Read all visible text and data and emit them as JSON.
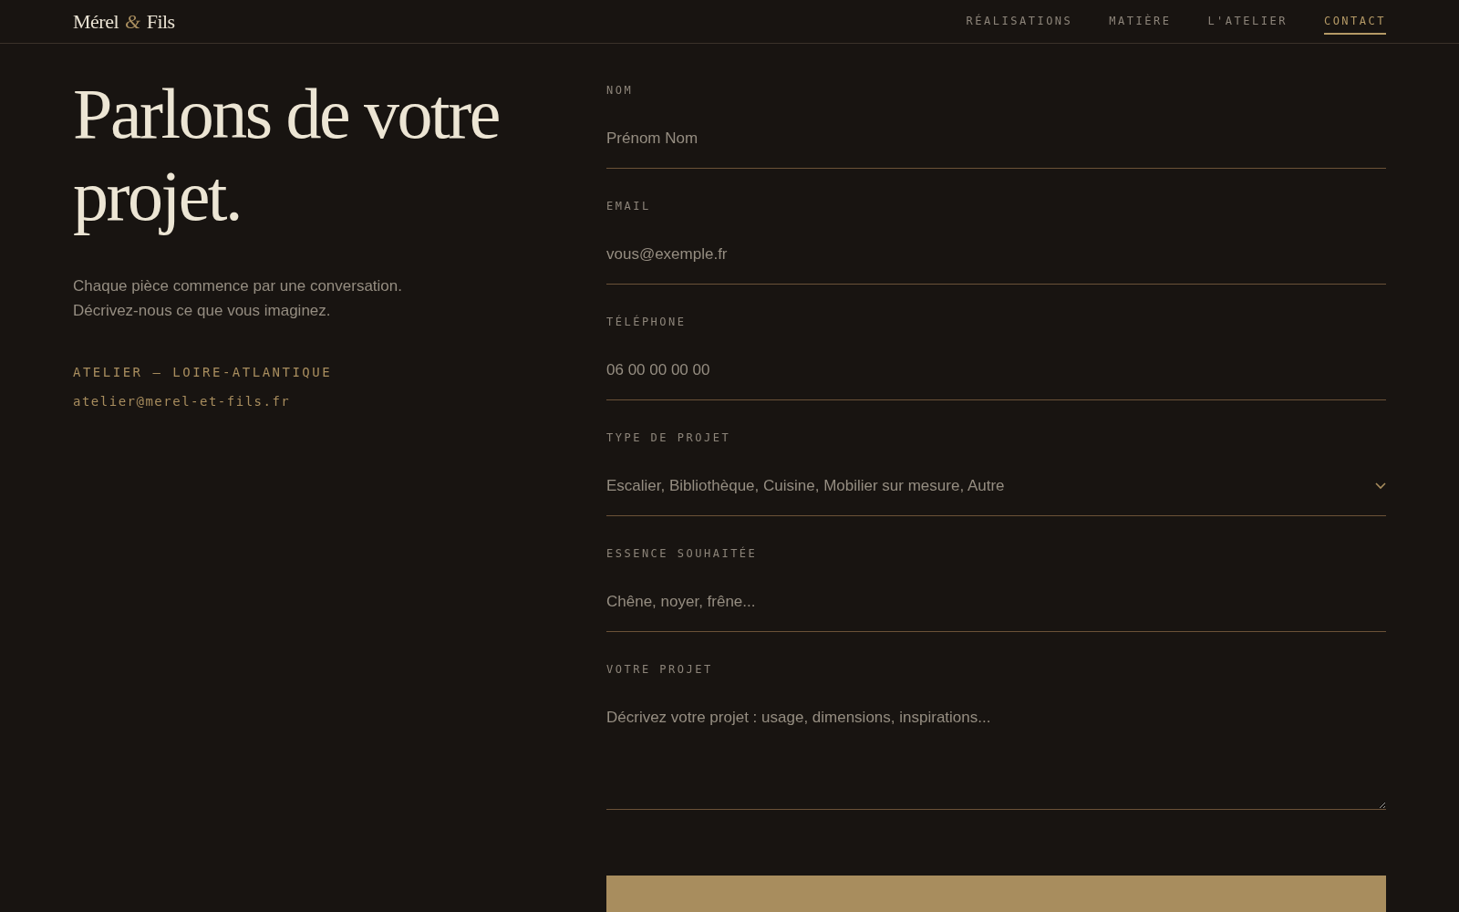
{
  "header": {
    "logo": {
      "first": "Mérel",
      "amp": "&",
      "last": "Fils"
    },
    "nav": [
      {
        "label": "RÉALISATIONS",
        "selected": false
      },
      {
        "label": "MATIÈRE",
        "selected": false
      },
      {
        "label": "L'ATELIER",
        "selected": false
      },
      {
        "label": "CONTACT",
        "selected": true
      }
    ]
  },
  "intro": {
    "title": "Parlons de votre projet.",
    "text": "Chaque pièce commence par une conversation. Décrivez-nous ce que vous imaginez.",
    "location": "ATELIER — LOIRE-ATLANTIQUE",
    "email": "atelier@merel-et-fils.fr"
  },
  "form": {
    "fields": [
      {
        "kind": "input",
        "label": "NOM",
        "placeholder": "Prénom Nom"
      },
      {
        "kind": "input",
        "label": "EMAIL",
        "placeholder": "vous@exemple.fr"
      },
      {
        "kind": "input",
        "label": "TÉLÉPHONE",
        "placeholder": "06 00 00 00 00"
      },
      {
        "kind": "select",
        "label": "TYPE DE PROJET",
        "value": "Escalier, Bibliothèque, Cuisine, Mobilier sur mesure, Autre"
      },
      {
        "kind": "input",
        "label": "ESSENCE SOUHAITÉE",
        "placeholder": "Chêne, noyer, frêne..."
      },
      {
        "kind": "textarea",
        "label": "VOTRE PROJET",
        "placeholder": "Décrivez votre projet : usage, dimensions, inspirations..."
      }
    ]
  }
}
